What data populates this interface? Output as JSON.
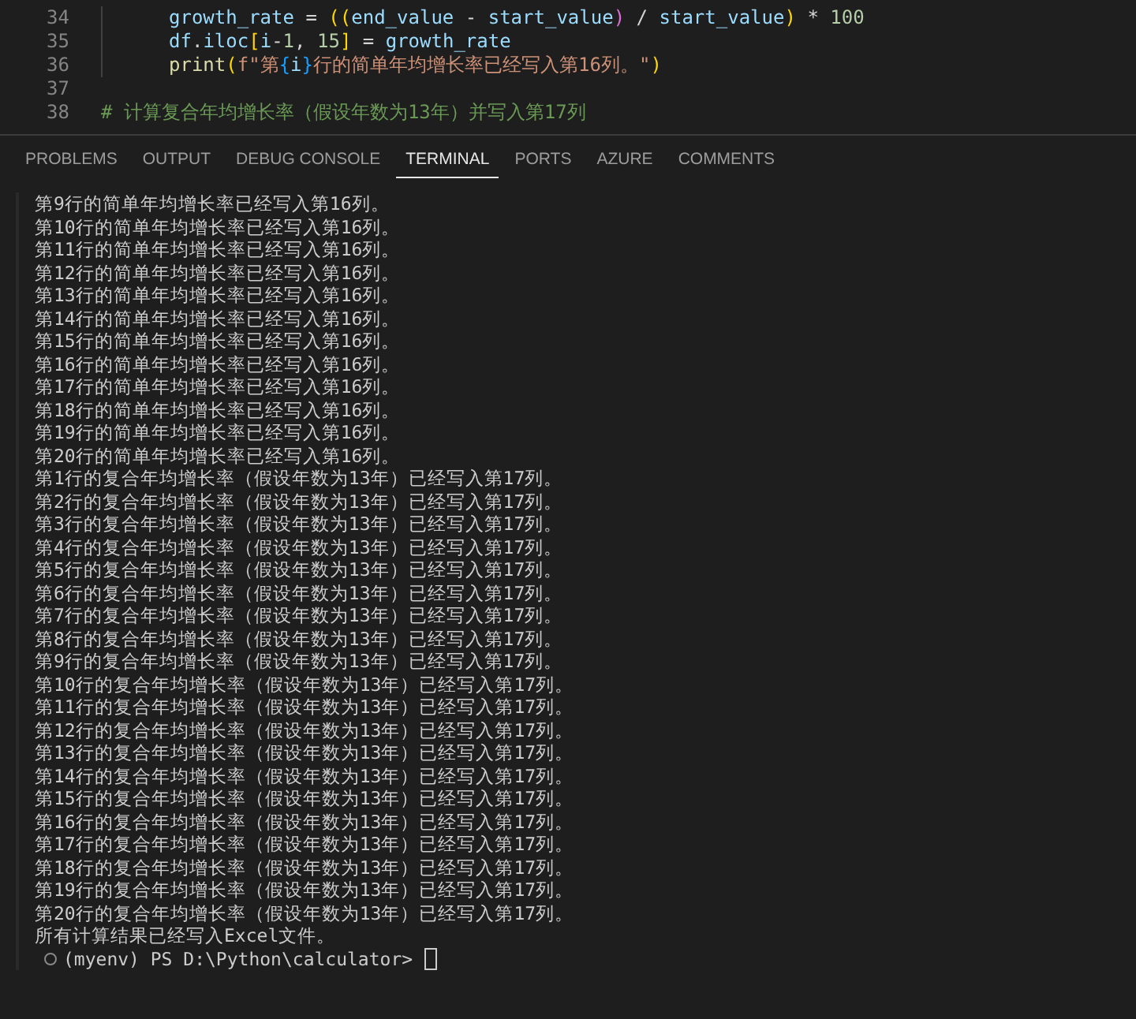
{
  "editor": {
    "lines": [
      {
        "number": "34",
        "indent": true,
        "tokens": [
          {
            "text": "growth_rate",
            "kind": "var"
          },
          {
            "text": " = ",
            "kind": "op"
          },
          {
            "text": "((",
            "kind": "paren1"
          },
          {
            "text": "end_value",
            "kind": "var"
          },
          {
            "text": " - ",
            "kind": "op"
          },
          {
            "text": "start_value",
            "kind": "var"
          },
          {
            "text": ")",
            "kind": "paren2"
          },
          {
            "text": " / ",
            "kind": "op"
          },
          {
            "text": "start_value",
            "kind": "var"
          },
          {
            "text": ")",
            "kind": "paren1"
          },
          {
            "text": " * ",
            "kind": "op"
          },
          {
            "text": "100",
            "kind": "number"
          }
        ]
      },
      {
        "number": "35",
        "indent": true,
        "tokens": [
          {
            "text": "df",
            "kind": "var"
          },
          {
            "text": ".",
            "kind": "op"
          },
          {
            "text": "iloc",
            "kind": "var"
          },
          {
            "text": "[",
            "kind": "paren1"
          },
          {
            "text": "i",
            "kind": "var"
          },
          {
            "text": "-",
            "kind": "op"
          },
          {
            "text": "1",
            "kind": "number"
          },
          {
            "text": ", ",
            "kind": "op"
          },
          {
            "text": "15",
            "kind": "number"
          },
          {
            "text": "]",
            "kind": "paren1"
          },
          {
            "text": " = ",
            "kind": "op"
          },
          {
            "text": "growth_rate",
            "kind": "var"
          }
        ]
      },
      {
        "number": "36",
        "indent": true,
        "tokens": [
          {
            "text": "print",
            "kind": "func"
          },
          {
            "text": "(",
            "kind": "paren1"
          },
          {
            "text": "f\"第",
            "kind": "string"
          },
          {
            "text": "{",
            "kind": "paren3"
          },
          {
            "text": "i",
            "kind": "var"
          },
          {
            "text": "}",
            "kind": "paren3"
          },
          {
            "text": "行的简单年均增长率已经写入第16列。\"",
            "kind": "string"
          },
          {
            "text": ")",
            "kind": "paren1"
          }
        ]
      },
      {
        "number": "37",
        "indent": false
      },
      {
        "number": "38",
        "indent": false,
        "tokens": [
          {
            "text": "# 计算复合年均增长率（假设年数为13年）并写入第17列",
            "kind": "comment"
          }
        ]
      }
    ]
  },
  "panel": {
    "tabs": [
      {
        "label": "PROBLEMS",
        "selected": false
      },
      {
        "label": "OUTPUT",
        "selected": false
      },
      {
        "label": "DEBUG CONSOLE",
        "selected": false
      },
      {
        "label": "TERMINAL",
        "selected": true
      },
      {
        "label": "PORTS",
        "selected": false
      },
      {
        "label": "AZURE",
        "selected": false
      },
      {
        "label": "COMMENTS",
        "selected": false
      }
    ]
  },
  "terminal": {
    "lines": [
      "第9行的简单年均增长率已经写入第16列。",
      "第10行的简单年均增长率已经写入第16列。",
      "第11行的简单年均增长率已经写入第16列。",
      "第12行的简单年均增长率已经写入第16列。",
      "第13行的简单年均增长率已经写入第16列。",
      "第14行的简单年均增长率已经写入第16列。",
      "第15行的简单年均增长率已经写入第16列。",
      "第16行的简单年均增长率已经写入第16列。",
      "第17行的简单年均增长率已经写入第16列。",
      "第18行的简单年均增长率已经写入第16列。",
      "第19行的简单年均增长率已经写入第16列。",
      "第20行的简单年均增长率已经写入第16列。",
      "第1行的复合年均增长率（假设年数为13年）已经写入第17列。",
      "第2行的复合年均增长率（假设年数为13年）已经写入第17列。",
      "第3行的复合年均增长率（假设年数为13年）已经写入第17列。",
      "第4行的复合年均增长率（假设年数为13年）已经写入第17列。",
      "第5行的复合年均增长率（假设年数为13年）已经写入第17列。",
      "第6行的复合年均增长率（假设年数为13年）已经写入第17列。",
      "第7行的复合年均增长率（假设年数为13年）已经写入第17列。",
      "第8行的复合年均增长率（假设年数为13年）已经写入第17列。",
      "第9行的复合年均增长率（假设年数为13年）已经写入第17列。",
      "第10行的复合年均增长率（假设年数为13年）已经写入第17列。",
      "第11行的复合年均增长率（假设年数为13年）已经写入第17列。",
      "第12行的复合年均增长率（假设年数为13年）已经写入第17列。",
      "第13行的复合年均增长率（假设年数为13年）已经写入第17列。",
      "第14行的复合年均增长率（假设年数为13年）已经写入第17列。",
      "第15行的复合年均增长率（假设年数为13年）已经写入第17列。",
      "第16行的复合年均增长率（假设年数为13年）已经写入第17列。",
      "第17行的复合年均增长率（假设年数为13年）已经写入第17列。",
      "第18行的复合年均增长率（假设年数为13年）已经写入第17列。",
      "第19行的复合年均增长率（假设年数为13年）已经写入第17列。",
      "第20行的复合年均增长率（假设年数为13年）已经写入第17列。",
      "所有计算结果已经写入Excel文件。"
    ],
    "prompt": "(myenv) PS D:\\Python\\calculator>"
  }
}
